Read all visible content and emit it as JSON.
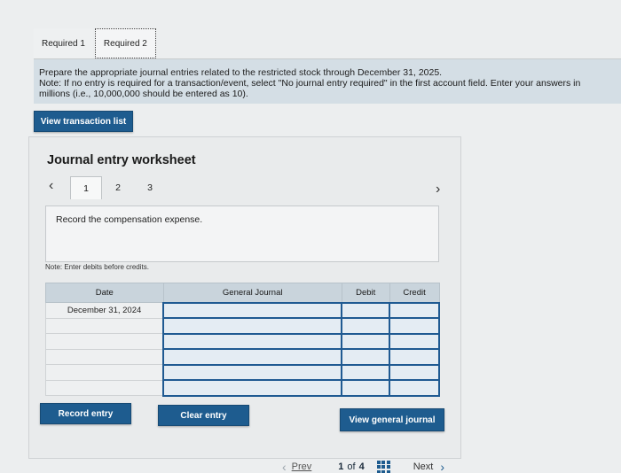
{
  "tabs": {
    "required1": "Required 1",
    "required2": "Required 2"
  },
  "instructions": {
    "line1": "Prepare the appropriate journal entries related to the restricted stock through December 31, 2025.",
    "line2": "Note: If no entry is required for a transaction/event, select \"No journal entry required\" in the first account field. Enter your answers in",
    "line3": "millions (i.e., 10,000,000 should be entered as 10)."
  },
  "buttons": {
    "view_transaction_list": "View transaction list",
    "record_entry": "Record entry",
    "clear_entry": "Clear entry",
    "view_general_journal": "View general journal"
  },
  "worksheet": {
    "title": "Journal entry worksheet",
    "pages": [
      "1",
      "2",
      "3"
    ],
    "active_page": "1",
    "description": "Record the compensation expense.",
    "note": "Note: Enter debits before credits."
  },
  "table": {
    "headers": {
      "date": "Date",
      "account": "General Journal",
      "debit": "Debit",
      "credit": "Credit"
    },
    "rows": [
      {
        "date": "December 31, 2024"
      },
      {
        "date": ""
      },
      {
        "date": ""
      },
      {
        "date": ""
      },
      {
        "date": ""
      },
      {
        "date": ""
      }
    ]
  },
  "footer": {
    "prev": "Prev",
    "page_current": "1",
    "page_of": "of",
    "page_total": "4",
    "next": "Next"
  },
  "colors": {
    "button_blue": "#1e5c8f",
    "instruction_bg": "#d4dee5",
    "header_bg": "#c9d4dc"
  }
}
